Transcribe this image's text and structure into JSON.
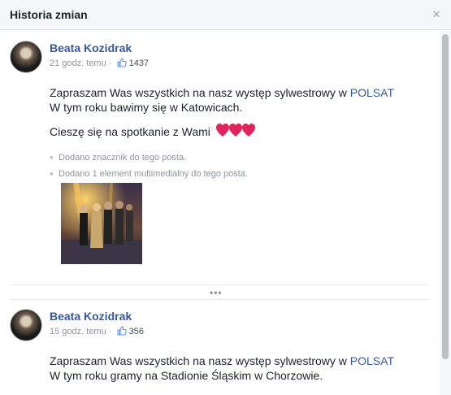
{
  "dialog": {
    "title": "Historia zmian",
    "close_symbol": "×"
  },
  "posts": [
    {
      "author": "Beata Kozidrak",
      "time": "21 godz. temu",
      "separator": "·",
      "likes": "1437",
      "line1_prefix": "Zapraszam Was wszystkich na nasz występ sylwestrowy w ",
      "line1_link": "POLSAT",
      "line2": "W tym roku bawimy się w Katowicach.",
      "line3": "Cieszę się na spotkanie z Wami",
      "changes": [
        "Dodano znacznik do tego posta.",
        "Dodano 1 element multimedialny do tego posta."
      ]
    },
    {
      "author": "Beata Kozidrak",
      "time": "15 godz. temu",
      "separator": "·",
      "likes": "356",
      "line1_prefix": "Zapraszam Was wszystkich na nasz występ sylwestrowy w ",
      "line1_link": "POLSAT",
      "line2": "W tym roku gramy na Stadionie Śląskim w Chorzowie."
    }
  ],
  "more_indicator": "•••",
  "icons": {
    "close": "close-icon",
    "like": "thumbs-up-icon",
    "hearts": "heart-emoji-icon"
  },
  "colors": {
    "link": "#365899",
    "heart": "#e0245e"
  }
}
